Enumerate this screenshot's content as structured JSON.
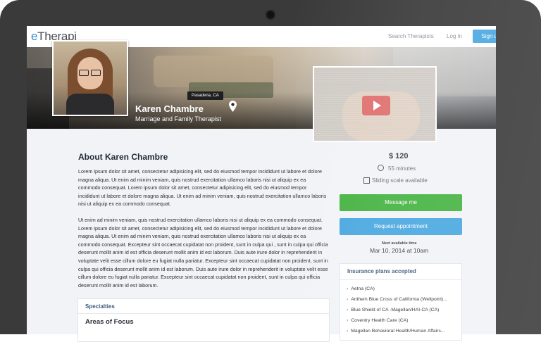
{
  "app": {
    "logo": "eTherapi",
    "logo_e": "e",
    "logo_rest": "Therapi"
  },
  "nav": {
    "search_therapists": "Search Therapists",
    "log_in": "Log in",
    "sign_up": "Sign up"
  },
  "profile": {
    "location": "Pasadena, CA",
    "name": "Karen Chambre",
    "role": "Marriage and Family Therapist"
  },
  "about": {
    "title": "About Karen Chambre",
    "paragraph_1": "Lorem ipsum dolor sit amet, consectetur adipisicing elit, sed do eiusmod tempor incididunt ut labore et dolore magna aliqua. Ut enim ad minim veniam, quis nostrud exercitation ullamco laboris nisi ut aliquip ex ea commodo consequat. Lorem ipsum dolor sit amet, consectetur adipisicing elit, sed do eiusmod tempor incididunt ut labore et dolore magna aliqua. Ut enim ad minim veniam, quis nostrud exercitation ullamco laboris nisi ut aliquip ex ea commodo consequat.",
    "paragraph_2": "Ut enim ad minim veniam, quis nostrud exercitation ullamco laboris nisi ut aliquip ex ea commodo consequat. Lorem ipsum dolor sit amet, consectetur adipisicing elit, sed do eiusmod tempor incididunt ut labore et dolore magna aliqua. Ut enim ad minim veniam, quis nostrud exercitation ullamco laboris nisi ut aliquip ex ea commodo consequat. Excepteur sint occaecat cupidatat non proident, sunt in culpa qui , sunt in culpa qui officia deserunt mollit anim id est officia deserunt mollit anim id est laborum. Duis aute irure dolor in reprehenderit in voluptate velit esse cillum dolore eu fugiat nulla pariatur. Excepteur sint occaecat cupidatat non proident, sunt in culpa qui officia deserunt mollit anim id est laborum. Duis aute irure dolor in reprehenderit in voluptate velit esse cillum dolore eu fugiat nulla pariatur. Excepteur sint occaecat cupidatat non proident, sunt in culpa qui officia deserunt mollit anim id est laborum."
  },
  "specialties": {
    "header": "Specialties",
    "sub": "Areas of Focus"
  },
  "pricing": {
    "price": "$ 120",
    "duration": "55 minutes",
    "sliding": "Sliding scale available"
  },
  "actions": {
    "message": "Message me",
    "request": "Request appointment"
  },
  "availability": {
    "label": "Next available time",
    "time": "Mar 10, 2014 at 10am"
  },
  "insurance": {
    "header": "Insurance plans accepted",
    "items": [
      "Aetna (CA)",
      "Anthem Blue Cross of California (Wellpoint)...",
      "Blue Shield of CA -Magellan/HAI-CA (CA)",
      "Coventry Health Care (CA)",
      "Magellan Behavioral Health/Human Affairs..."
    ]
  },
  "colors": {
    "brand_blue": "#4aa8e0",
    "message_green": "#46b342"
  },
  "icons": [
    "camera-icon",
    "location-pin-icon",
    "play-icon",
    "clock-icon",
    "calendar-icon",
    "chevron-right-icon"
  ]
}
